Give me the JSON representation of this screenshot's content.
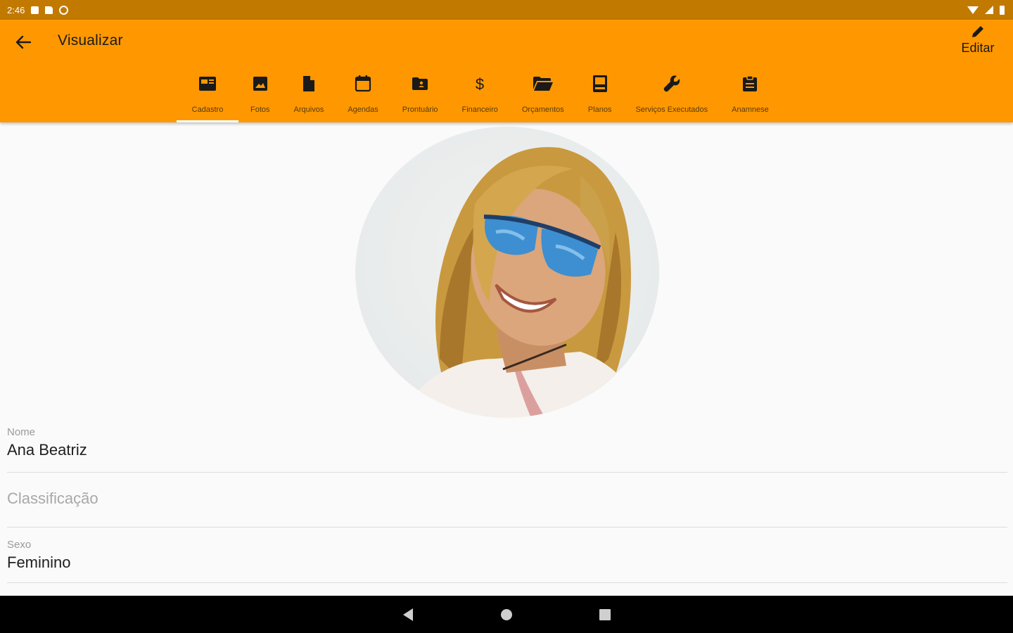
{
  "status_bar": {
    "time": "2:46",
    "left_icons": [
      "notification-square-icon",
      "sim-card-icon",
      "data-saver-icon"
    ],
    "right_icons": [
      "wifi-icon",
      "signal-icon",
      "battery-icon"
    ]
  },
  "app_bar": {
    "title": "Visualizar",
    "back_icon": "arrow-back-icon",
    "edit_label": "Editar",
    "edit_icon": "pencil-icon",
    "background_color": "#ff9800",
    "status_color": "#c17900"
  },
  "tabs": [
    {
      "id": "cadastro",
      "label": "Cadastro",
      "icon": "id-card-icon",
      "active": true
    },
    {
      "id": "fotos",
      "label": "Fotos",
      "icon": "image-icon",
      "active": false
    },
    {
      "id": "arquivos",
      "label": "Arquivos",
      "icon": "file-icon",
      "active": false
    },
    {
      "id": "agendas",
      "label": "Agendas",
      "icon": "calendar-icon",
      "active": false
    },
    {
      "id": "prontuario",
      "label": "Prontuário",
      "icon": "folder-account-icon",
      "active": false
    },
    {
      "id": "financeiro",
      "label": "Financeiro",
      "icon": "dollar-icon",
      "active": false
    },
    {
      "id": "orcamentos",
      "label": "Orçamentos",
      "icon": "folder-open-icon",
      "active": false
    },
    {
      "id": "planos",
      "label": "Planos",
      "icon": "book-icon",
      "active": false
    },
    {
      "id": "servicos",
      "label": "Serviços Executados",
      "icon": "wrench-icon",
      "active": false
    },
    {
      "id": "anamnese",
      "label": "Anamnese",
      "icon": "clipboard-icon",
      "active": false
    }
  ],
  "profile": {
    "photo_icon": "profile-photo"
  },
  "fields": {
    "nome": {
      "label": "Nome",
      "value": "Ana Beatriz"
    },
    "classificacao": {
      "placeholder": "Classificação"
    },
    "sexo": {
      "label": "Sexo",
      "value": "Feminino"
    }
  },
  "nav_bar": {
    "icons": [
      "nav-back-icon",
      "nav-home-icon",
      "nav-recents-icon"
    ]
  }
}
